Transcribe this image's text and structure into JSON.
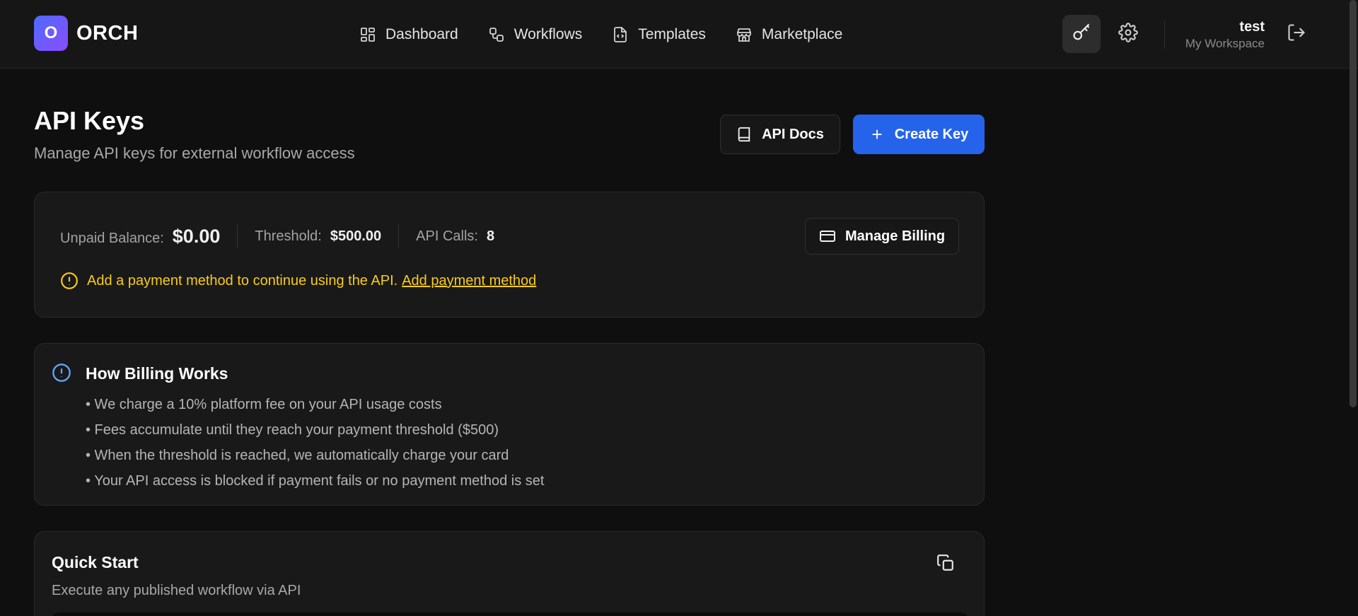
{
  "header": {
    "logo_letter": "O",
    "brand": "ORCH",
    "nav": [
      {
        "label": "Dashboard",
        "icon": "grid-icon"
      },
      {
        "label": "Workflows",
        "icon": "workflow-icon"
      },
      {
        "label": "Templates",
        "icon": "file-code-icon"
      },
      {
        "label": "Marketplace",
        "icon": "store-icon"
      }
    ],
    "user_name": "test",
    "workspace": "My Workspace"
  },
  "page": {
    "title": "API Keys",
    "subtitle": "Manage API keys for external workflow access",
    "docs_label": "API Docs",
    "create_label": "Create Key"
  },
  "billing": {
    "unpaid_label": "Unpaid Balance:",
    "unpaid_value": "$0.00",
    "threshold_label": "Threshold:",
    "threshold_value": "$500.00",
    "calls_label": "API Calls:",
    "calls_value": "8",
    "manage_label": "Manage Billing",
    "warning_text": "Add a payment method to continue using the API.",
    "warning_link": "Add payment method"
  },
  "how": {
    "title": "How Billing Works",
    "items": [
      "• We charge a 10% platform fee on your API usage costs",
      "• Fees accumulate until they reach your payment threshold ($500)",
      "• When the threshold is reached, we automatically charge your card",
      "• Your API access is blocked if payment fails or no payment method is set"
    ]
  },
  "quick": {
    "title": "Quick Start",
    "subtitle": "Execute any published workflow via API"
  },
  "colors": {
    "accent": "#2563eb",
    "warning": "#facc15",
    "info": "#60a5fa",
    "background": "#0f0f0f"
  }
}
